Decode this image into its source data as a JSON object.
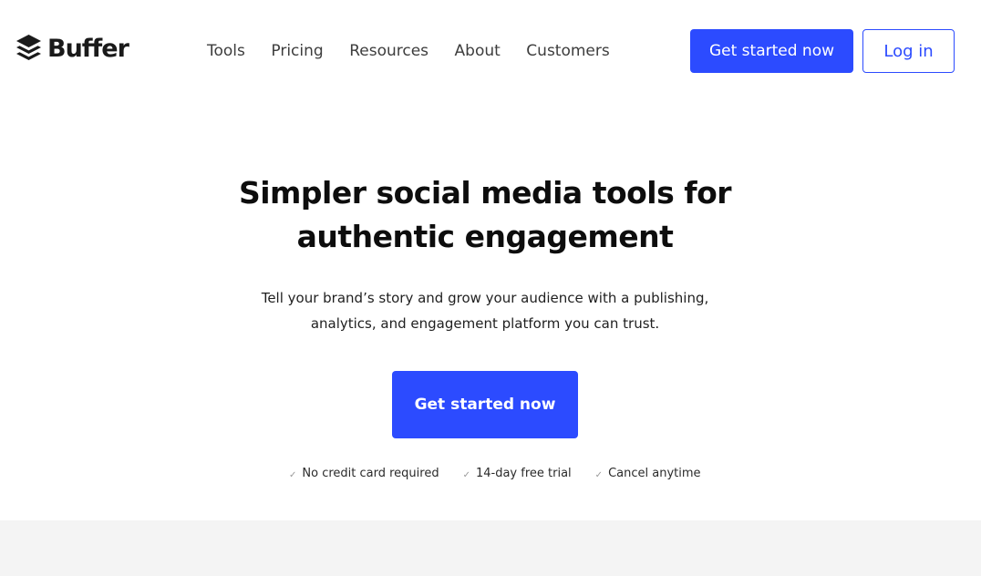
{
  "brand": {
    "name": "Buffer",
    "logo_icon": "stacked-layers-icon",
    "accent_color": "#2c4bff"
  },
  "nav": {
    "items": [
      {
        "label": "Tools"
      },
      {
        "label": "Pricing"
      },
      {
        "label": "Resources"
      },
      {
        "label": "About"
      },
      {
        "label": "Customers"
      }
    ]
  },
  "header_actions": {
    "get_started_label": "Get started now",
    "login_label": "Log in"
  },
  "hero": {
    "title_line1": "Simpler social media tools for",
    "title_line2": "authentic engagement",
    "subtitle_line1": "Tell your brand’s story and grow your audience with a publishing,",
    "subtitle_line2": "analytics, and engagement platform you can trust.",
    "cta_label": "Get started now"
  },
  "perks": [
    {
      "icon": "check-icon",
      "label": "No credit card required"
    },
    {
      "icon": "check-icon",
      "label": "14-day free trial"
    },
    {
      "icon": "check-icon",
      "label": "Cancel anytime"
    }
  ]
}
